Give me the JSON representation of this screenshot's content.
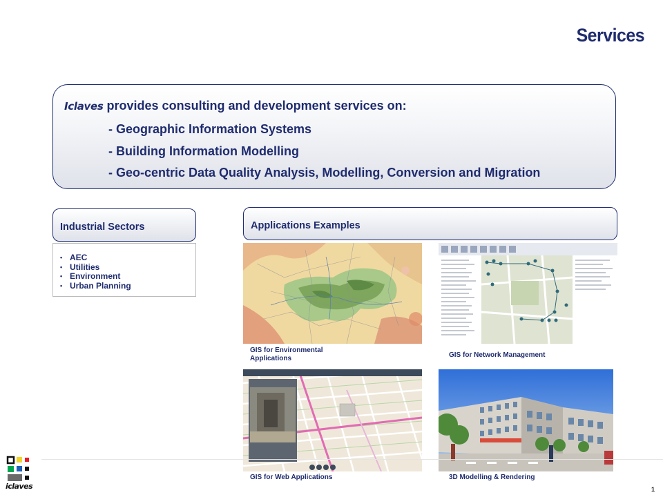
{
  "slide": {
    "title": "Services",
    "page_number": "1"
  },
  "intro": {
    "brand": "Iclaves",
    "lead": " provides consulting and development services on:",
    "services": [
      "- Geographic Information Systems",
      "- Building Information Modelling",
      "- Geo-centric Data Quality Analysis, Modelling, Conversion and Migration"
    ]
  },
  "sectors": {
    "header": "Industrial Sectors",
    "items": [
      "AEC",
      "Utilities",
      "Environment",
      "Urban Planning"
    ]
  },
  "applications": {
    "header": "Applications Examples",
    "examples": [
      {
        "caption_line1": "GIS for Environmental",
        "caption_line2": "Applications"
      },
      {
        "caption_line1": "GIS for Network Management",
        "caption_line2": ""
      },
      {
        "caption_line1": "GIS for Web Applications",
        "caption_line2": ""
      },
      {
        "caption_line1": "3D Modelling & Rendering",
        "caption_line2": ""
      }
    ]
  },
  "logo": {
    "wordmark": "iclaves"
  },
  "colors": {
    "brand_navy": "#1f2c6e"
  }
}
